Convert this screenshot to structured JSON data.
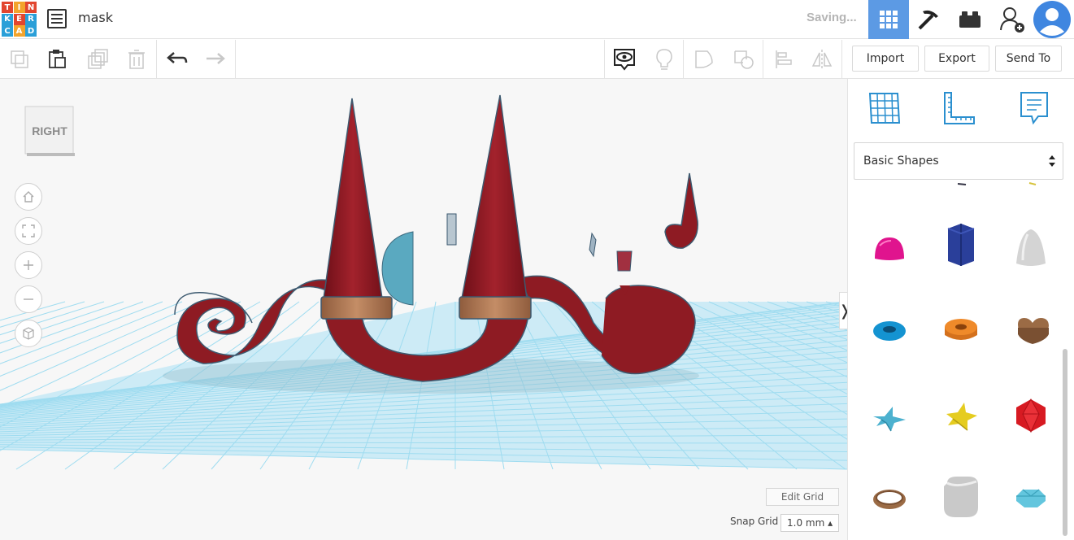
{
  "app": {
    "logo_letters": [
      "T",
      "I",
      "N",
      "K",
      "E",
      "R",
      "C",
      "A",
      "D"
    ],
    "logo_colors": [
      "#e2462f",
      "#f3a42c",
      "#e2462f",
      "#2a9fd8",
      "#e2462f",
      "#2a9fd8",
      "#2a9fd8",
      "#f3a42c",
      "#2a9fd8"
    ]
  },
  "header": {
    "title": "mask",
    "status": "Saving...",
    "view_buttons": [
      "3d-design-view",
      "blocks-view",
      "bricks-view",
      "share-user",
      "user-profile"
    ]
  },
  "toolbar": {
    "import_label": "Import",
    "export_label": "Export",
    "send_to_label": "Send To"
  },
  "viewport": {
    "view_cube_label": "RIGHT",
    "edit_grid_label": "Edit Grid",
    "snap_grid_label": "Snap Grid",
    "snap_grid_value": "1.0 mm ▴"
  },
  "panel": {
    "shape_category": "Basic Shapes",
    "shapes": [
      "half-sphere",
      "polygon",
      "paraboloid",
      "torus",
      "tube",
      "heart",
      "star",
      "star-yellow",
      "icosahedron",
      "ring",
      "rounded-box",
      "gem"
    ]
  },
  "colors": {
    "accent": "#5c9ae4",
    "mask_red": "#8e1b23",
    "band_brown": "#a8714d",
    "grid_blue": "#9fdcf0"
  }
}
